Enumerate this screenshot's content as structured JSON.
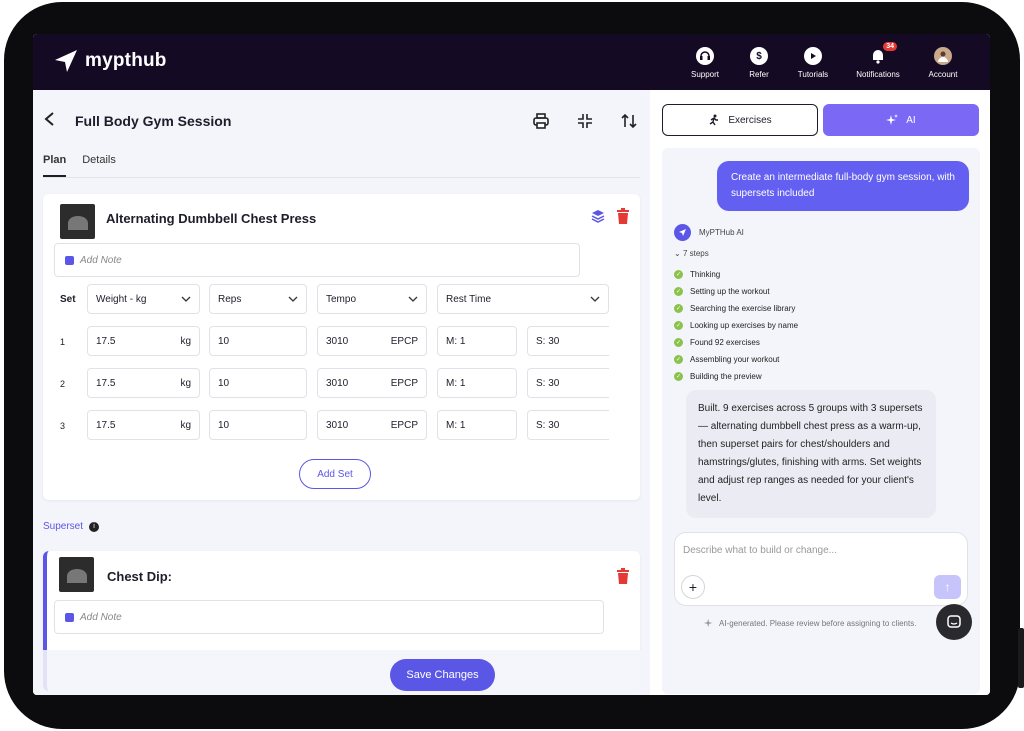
{
  "header": {
    "brand": "mypthub",
    "nav": [
      {
        "label": "Support",
        "icon": "headset-icon"
      },
      {
        "label": "Refer",
        "icon": "dollar-icon"
      },
      {
        "label": "Tutorials",
        "icon": "play-icon"
      },
      {
        "label": "Notifications",
        "icon": "bell-icon",
        "badge": "34"
      },
      {
        "label": "Account",
        "icon": "avatar-icon"
      }
    ]
  },
  "workout": {
    "title": "Full Body Gym Session",
    "tabs": [
      "Plan",
      "Details"
    ],
    "active_tab": "Plan",
    "exercise1": {
      "name": "Alternating Dumbbell Chest Press",
      "note_placeholder": "Add Note",
      "set_label": "Set",
      "columns": [
        "Weight - kg",
        "Reps",
        "Tempo",
        "Rest Time"
      ],
      "rows": [
        {
          "set": "1",
          "weight": "17.5",
          "weight_unit": "kg",
          "reps": "10",
          "tempo": "3010",
          "tempo_unit": "EPCP",
          "rest_m": "M:  1",
          "rest_s": "S:  30"
        },
        {
          "set": "2",
          "weight": "17.5",
          "weight_unit": "kg",
          "reps": "10",
          "tempo": "3010",
          "tempo_unit": "EPCP",
          "rest_m": "M:  1",
          "rest_s": "S:  30"
        },
        {
          "set": "3",
          "weight": "17.5",
          "weight_unit": "kg",
          "reps": "10",
          "tempo": "3010",
          "tempo_unit": "EPCP",
          "rest_m": "M:  1",
          "rest_s": "S:  30"
        }
      ],
      "add_set": "Add Set"
    },
    "superset_label": "Superset",
    "exercise2": {
      "name": "Chest Dip:",
      "note_placeholder": "Add Note"
    },
    "save_label": "Save Changes"
  },
  "ai_panel": {
    "tab_exercises": "Exercises",
    "tab_ai": "AI",
    "user_message": "Create an intermediate full-body gym session, with supersets included",
    "assistant_name": "MyPTHub AI",
    "steps_count": "7 steps",
    "steps": [
      "Thinking",
      "Setting up the workout",
      "Searching the exercise library",
      "Looking up exercises by name",
      "Found 92 exercises",
      "Assembling your workout",
      "Building the preview"
    ],
    "assistant_reply": "Built. 9 exercises across 5 groups with 3 supersets — alternating dumbbell chest press as a warm-up, then superset pairs for chest/shoulders and hamstrings/glutes, finishing with arms. Set weights and adjust rep ranges as needed for your client's level.",
    "input_placeholder": "Describe what to build or change...",
    "disclaimer": "AI-generated. Please review before assigning to clients."
  },
  "colors": {
    "brand_dark": "#150a24",
    "accent": "#5b57e6",
    "delete_red": "#e53935",
    "success_green": "#8bc34a"
  }
}
